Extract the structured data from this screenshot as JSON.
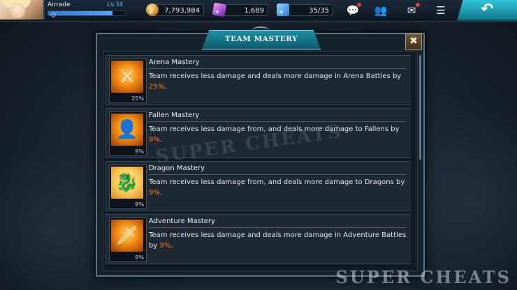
{
  "player": {
    "name": "Airrade",
    "level": "Lv.34",
    "xp_fraction": 0.84
  },
  "resources": {
    "gold": "7,793,984",
    "gems": "1,689",
    "energy": "35/35"
  },
  "icons": {
    "chat": "chat-icon",
    "friends": "friends-icon",
    "mail": "mail-icon",
    "menu": "menu-icon",
    "back": "back-arrow-icon",
    "settings": "gear-icon"
  },
  "dialog": {
    "title": "TEAM MASTERY",
    "close": "✖"
  },
  "masteries": [
    {
      "name": "Arena Mastery",
      "desc_pre": "Team receives less damage and deals more damage in Arena Battles by ",
      "value": "25%",
      "desc_post": ".",
      "percent": "25%",
      "icon": "crossed-swords-icon"
    },
    {
      "name": "Fallen Mastery",
      "desc_pre": "Team receives less damage from, and deals more damage to Fallens by ",
      "value": "9%",
      "desc_post": ".",
      "percent": "9%",
      "icon": "fallen-figure-icon"
    },
    {
      "name": "Dragon Mastery",
      "desc_pre": "Team receives less damage from, and deals more damage to Dragons by ",
      "value": "9%",
      "desc_post": ".",
      "percent": "9%",
      "icon": "dragon-head-icon"
    },
    {
      "name": "Adventure Mastery",
      "desc_pre": "Team receives less damage and deals more damage in Adventure Battles by ",
      "value": "9%",
      "desc_post": ".",
      "percent": "9%",
      "icon": "adventure-helm-sword-icon"
    }
  ],
  "watermark": {
    "center": "SUPER CHEATS",
    "footer": "SUPER CHEATS"
  },
  "colors": {
    "highlight": "#ff7a1a",
    "title_tab": "#1e8fa4",
    "accent_back": "#2ec3d6"
  }
}
